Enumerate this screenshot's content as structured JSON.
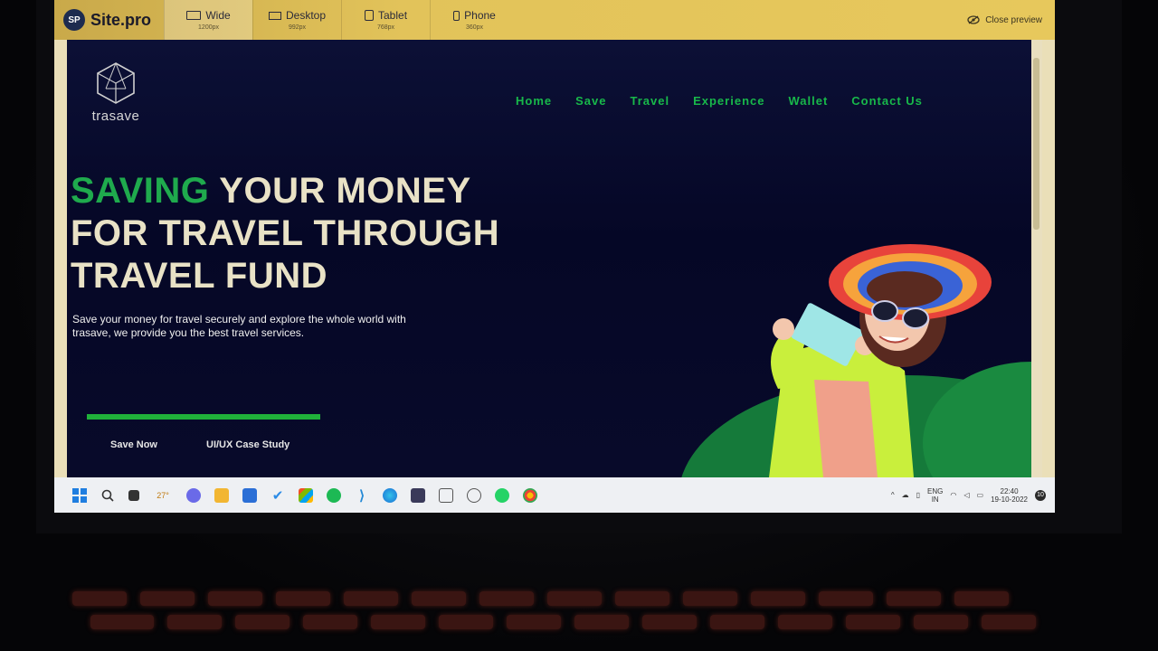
{
  "toolbar": {
    "brand_badge": "SP",
    "brand_name": "Site.pro",
    "devices": [
      {
        "label": "Wide",
        "size": "1200px"
      },
      {
        "label": "Desktop",
        "size": "992px"
      },
      {
        "label": "Tablet",
        "size": "768px"
      },
      {
        "label": "Phone",
        "size": "360px"
      }
    ],
    "close_preview": "Close preview"
  },
  "site": {
    "logo_text": "trasave",
    "nav": [
      "Home",
      "Save",
      "Travel",
      "Experience",
      "Wallet",
      "Contact Us"
    ],
    "hero": {
      "title_accent": "SAVING",
      "title_line1_rest": " YOUR MONEY",
      "title_line2": "FOR TRAVEL THROUGH",
      "title_line3": "TRAVEL FUND",
      "description": "Save your money for travel securely and explore the whole world with trasave, we provide you the best travel services."
    },
    "buttons": {
      "save_now": "Save Now",
      "case_study": "UI/UX Case Study"
    }
  },
  "taskbar": {
    "weather": "27°",
    "language": "ENG",
    "region": "IN",
    "time": "22:40",
    "date": "19-10-2022",
    "notifications": "10"
  },
  "colors": {
    "accent_green": "#1faa4d",
    "site_bg": "#050726",
    "toolbar_bg": "#e2c35a"
  }
}
